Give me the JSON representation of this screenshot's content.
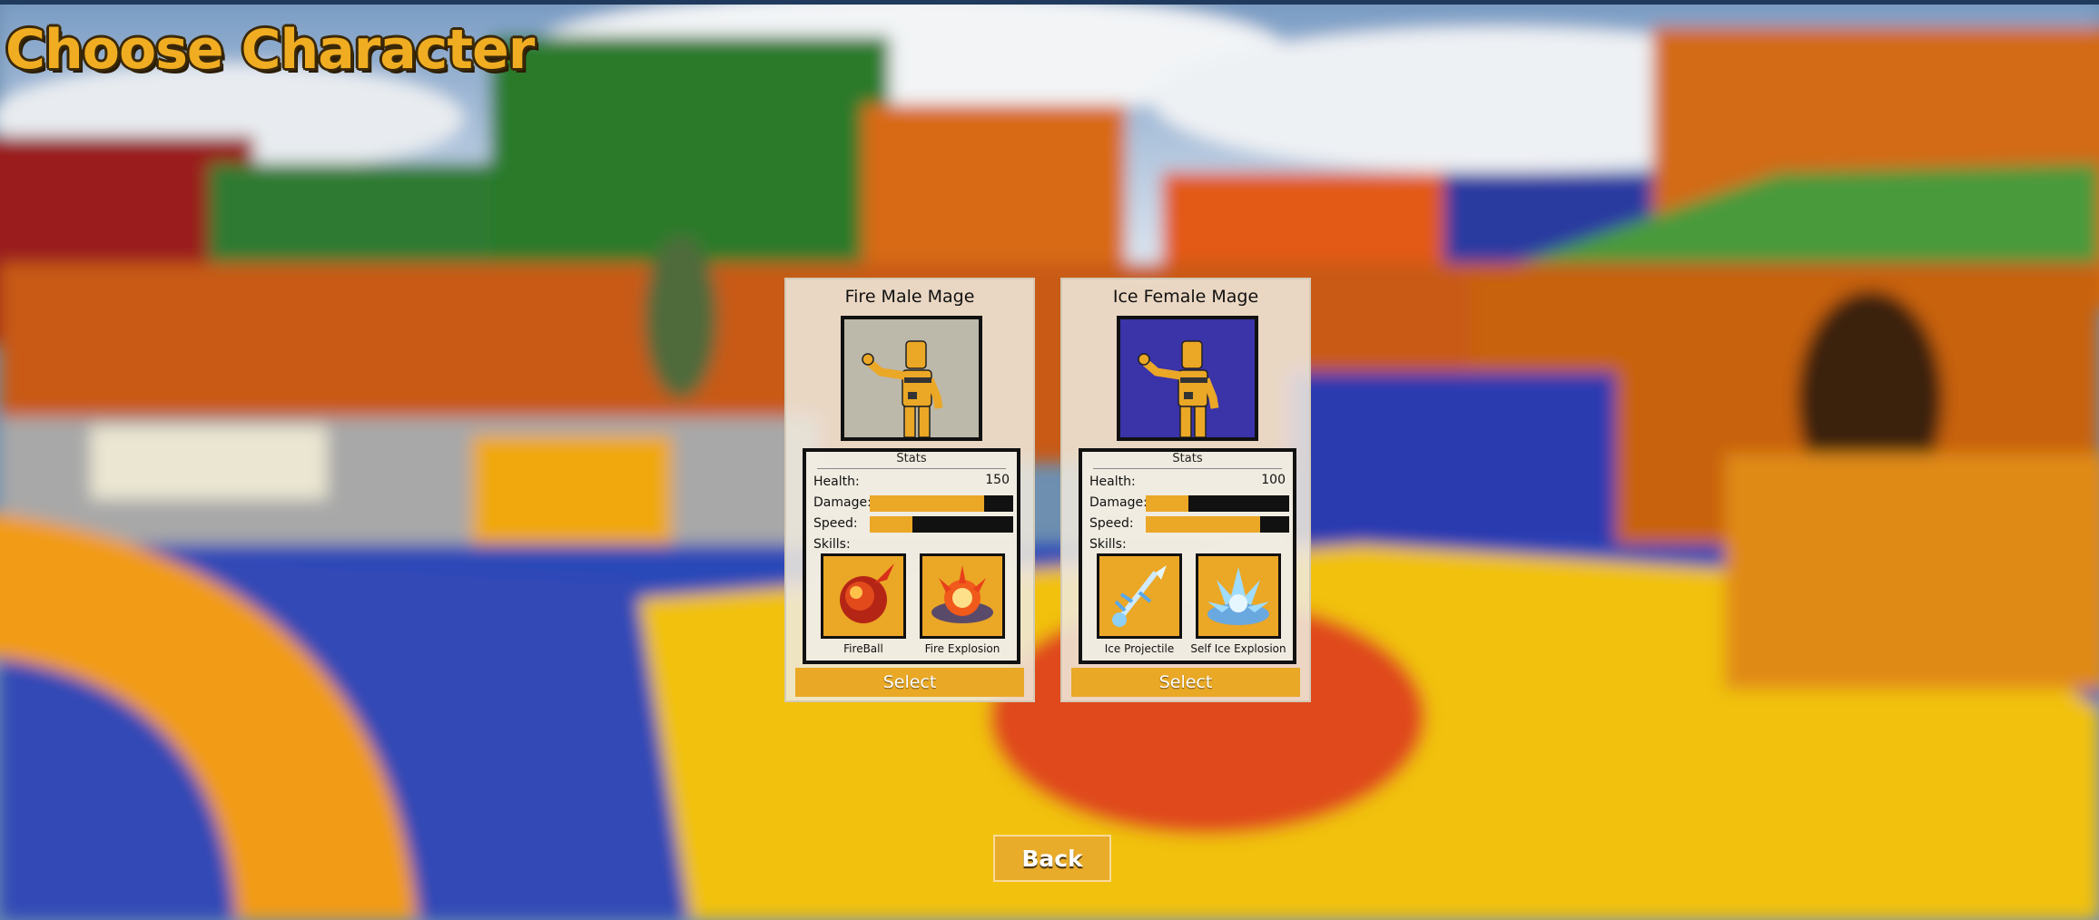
{
  "screen": {
    "title": "Choose Character",
    "back_label": "Back"
  },
  "colors": {
    "accent": "#eba726",
    "title_outline": "#3a2808",
    "fire_portrait_bg": "#bcb8aa",
    "ice_portrait_bg": "#3b33a8"
  },
  "characters": [
    {
      "name": "Fire Male Mage",
      "stats_title": "Stats",
      "health_label": "Health:",
      "health_value": "150",
      "damage_label": "Damage:",
      "damage_fill": 0.8,
      "speed_label": "Speed:",
      "speed_fill": 0.3,
      "skills_label": "Skills:",
      "skills": [
        {
          "name": "FireBall",
          "icon": "fireball-icon"
        },
        {
          "name": "Fire Explosion",
          "icon": "fire-explosion-icon"
        }
      ],
      "select_label": "Select"
    },
    {
      "name": "Ice Female Mage",
      "stats_title": "Stats",
      "health_label": "Health:",
      "health_value": "100",
      "damage_label": "Damage:",
      "damage_fill": 0.3,
      "speed_label": "Speed:",
      "speed_fill": 0.8,
      "skills_label": "Skills:",
      "skills": [
        {
          "name": "Ice Projectile",
          "icon": "ice-projectile-icon"
        },
        {
          "name": "Self Ice Explosion",
          "icon": "ice-explosion-icon"
        }
      ],
      "select_label": "Select"
    }
  ]
}
